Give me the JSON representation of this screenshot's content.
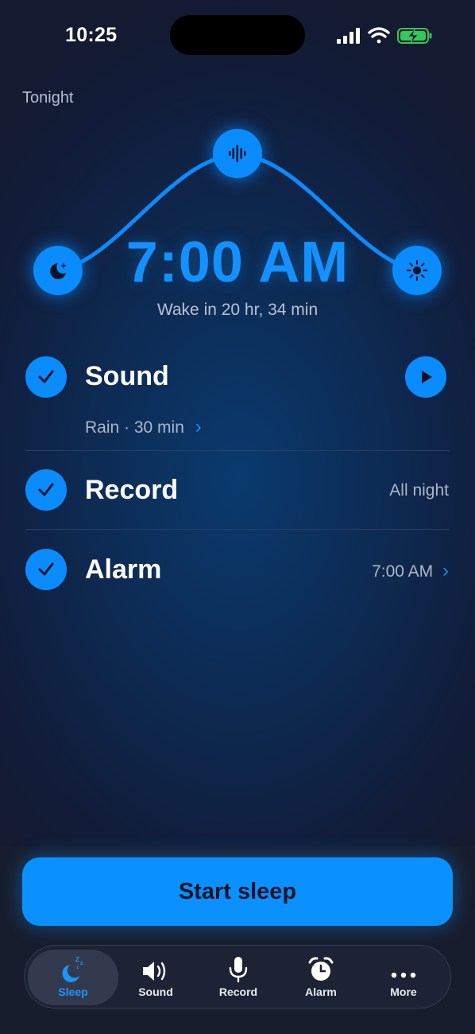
{
  "status_bar": {
    "time": "10:25"
  },
  "header": {
    "tonight": "Tonight"
  },
  "alarm": {
    "time": "7:00 AM",
    "wake_in": "Wake in 20 hr, 34 min"
  },
  "rows": {
    "sound": {
      "label": "Sound",
      "detail": "Rain · 30 min"
    },
    "record": {
      "label": "Record",
      "value": "All night"
    },
    "alarm": {
      "label": "Alarm",
      "value": "7:00 AM"
    }
  },
  "start_button": "Start sleep",
  "tabs": [
    {
      "label": "Sleep",
      "icon": "moon-zzz-icon",
      "active": true
    },
    {
      "label": "Sound",
      "icon": "speaker-icon",
      "active": false
    },
    {
      "label": "Record",
      "icon": "microphone-icon",
      "active": false
    },
    {
      "label": "Alarm",
      "icon": "alarm-clock-icon",
      "active": false
    },
    {
      "label": "More",
      "icon": "more-icon",
      "active": false
    }
  ],
  "colors": {
    "accent": "#0a8cff",
    "background": "#111d3a",
    "battery": "#34c759"
  }
}
